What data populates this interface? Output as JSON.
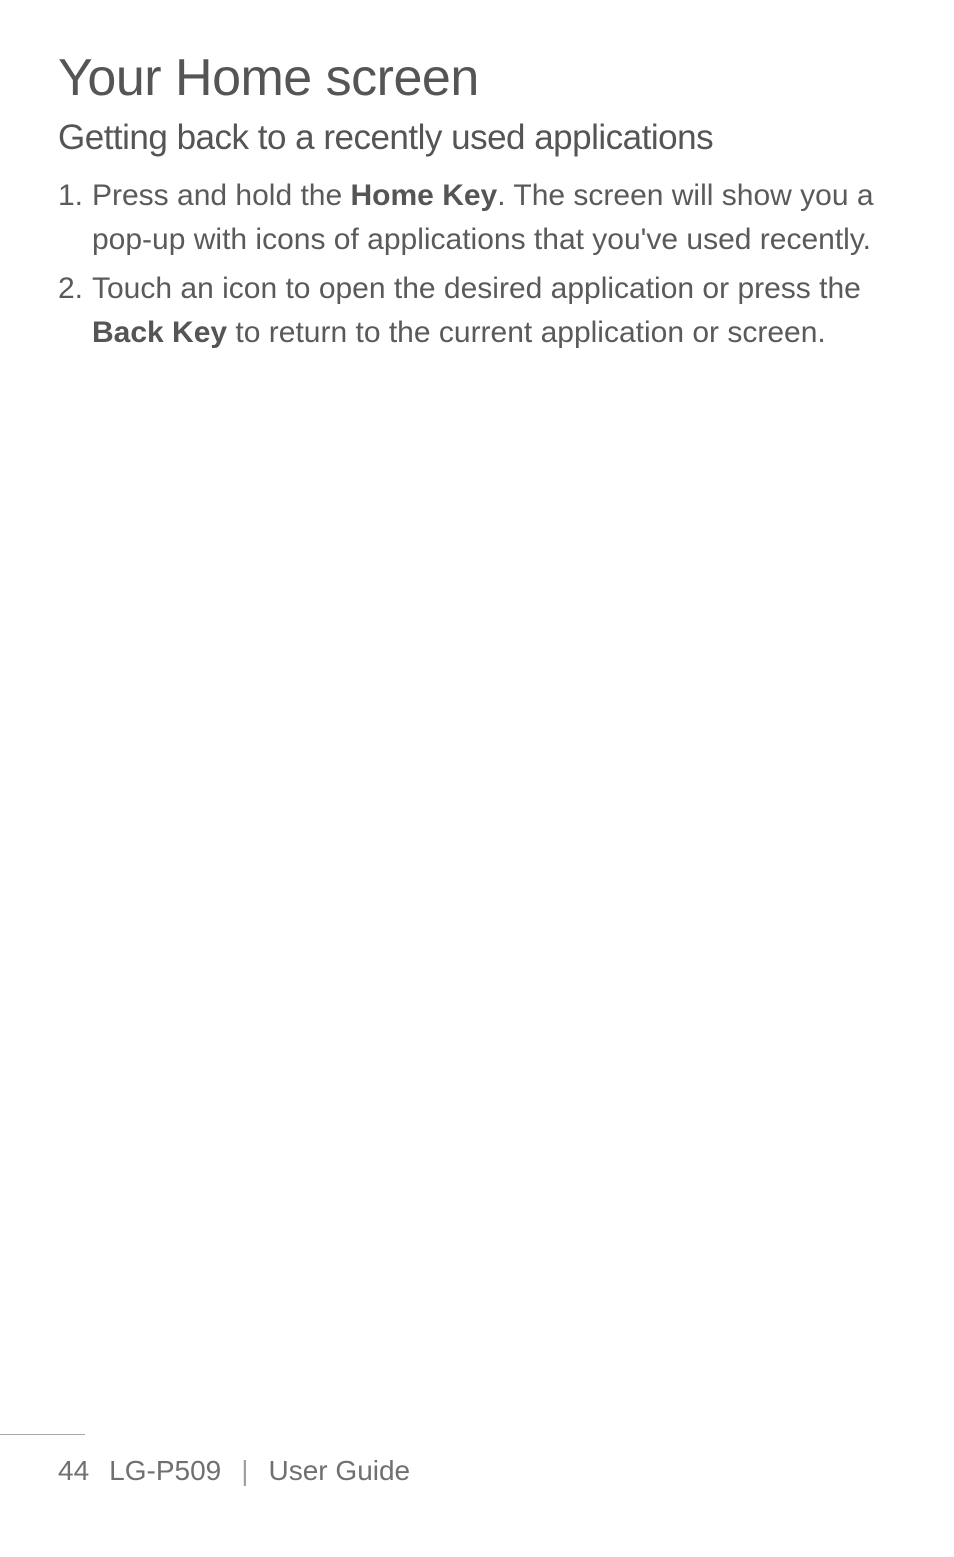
{
  "title": "Your Home screen",
  "subsection": "Getting back to a recently used applications",
  "steps": [
    {
      "marker": "1.",
      "pre": "Press and hold the ",
      "bold": "Home Key",
      "post": ". The screen will show you a pop-up with icons of applications that you've used recently."
    },
    {
      "marker": "2.",
      "pre": "Touch an icon to open the desired application or press the ",
      "bold": "Back Key",
      "post": " to return to the current application or screen."
    }
  ],
  "footer": {
    "page_number": "44",
    "model": "LG-P509",
    "separator": "|",
    "doc_label": "User Guide"
  }
}
